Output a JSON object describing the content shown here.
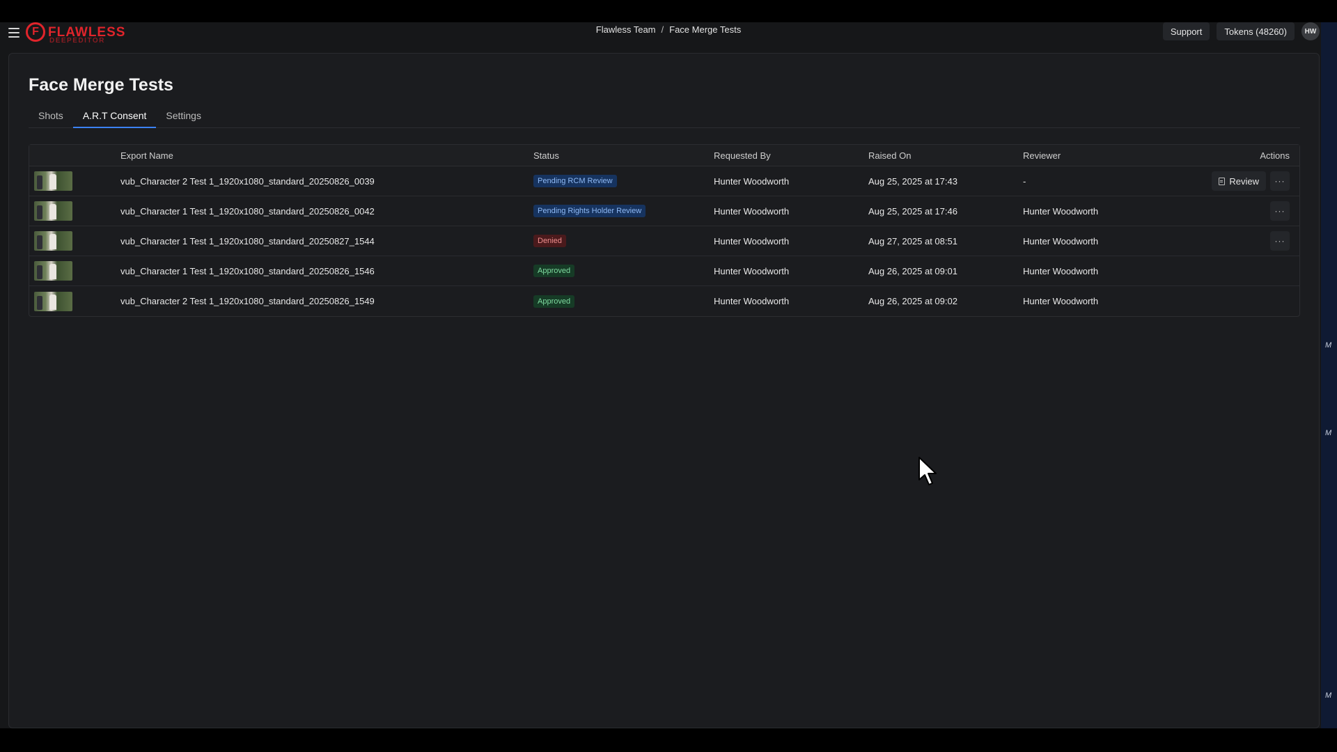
{
  "app": {
    "logo_main": "FLAWLESS",
    "logo_sub": "DEEPEDITOR",
    "logo_mark": "F"
  },
  "breadcrumb": {
    "team": "Flawless Team",
    "separator": "/",
    "project": "Face Merge Tests"
  },
  "header": {
    "support_label": "Support",
    "tokens_label": "Tokens (48260)",
    "avatar_initials": "HW"
  },
  "page": {
    "title": "Face Merge Tests"
  },
  "tabs": [
    {
      "label": "Shots",
      "active": false
    },
    {
      "label": "A.R.T Consent",
      "active": true
    },
    {
      "label": "Settings",
      "active": false
    }
  ],
  "table": {
    "columns": {
      "export_name": "Export Name",
      "status": "Status",
      "requested_by": "Requested By",
      "raised_on": "Raised On",
      "reviewer": "Reviewer",
      "actions": "Actions"
    },
    "rows": [
      {
        "name": "vub_Character 2 Test 1_1920x1080_standard_20250826_0039",
        "status": "Pending RCM Review",
        "requested_by": "Hunter Woodworth",
        "raised_on": "Aug 25, 2025 at 17:43",
        "reviewer": "-",
        "review_label": "Review",
        "more_label": "···"
      },
      {
        "name": "vub_Character 1 Test 1_1920x1080_standard_20250826_0042",
        "status": "Pending Rights Holder Review",
        "requested_by": "Hunter Woodworth",
        "raised_on": "Aug 25, 2025 at 17:46",
        "reviewer": "Hunter Woodworth",
        "more_label": "···"
      },
      {
        "name": "vub_Character 1 Test 1_1920x1080_standard_20250827_1544",
        "status": "Denied",
        "requested_by": "Hunter Woodworth",
        "raised_on": "Aug 27, 2025 at 08:51",
        "reviewer": "Hunter Woodworth",
        "more_label": "···"
      },
      {
        "name": "vub_Character 1 Test 1_1920x1080_standard_20250826_1546",
        "status": "Approved",
        "requested_by": "Hunter Woodworth",
        "raised_on": "Aug 26, 2025 at 09:01",
        "reviewer": "Hunter Woodworth"
      },
      {
        "name": "vub_Character 2 Test 1_1920x1080_standard_20250826_1549",
        "status": "Approved",
        "requested_by": "Hunter Woodworth",
        "raised_on": "Aug 26, 2025 at 09:02",
        "reviewer": "Hunter Woodworth"
      }
    ]
  },
  "colors": {
    "accent": "#3b82f6",
    "brand": "#e0242b",
    "pending": "#8fbaf5",
    "denied": "#f08f8f",
    "approved": "#7fdba0"
  },
  "side_strip": {
    "mark": "M"
  }
}
